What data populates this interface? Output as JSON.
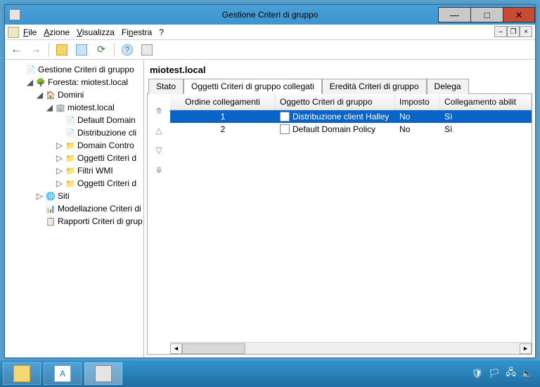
{
  "window": {
    "title": "Gestione Criteri di gruppo",
    "min": "—",
    "max": "□",
    "close": "✕"
  },
  "mdi": {
    "min": "–",
    "restore": "❐",
    "close": "×"
  },
  "menu": {
    "file": "File",
    "file_u": "F",
    "action": "Azione",
    "action_u": "A",
    "view": "Visualizza",
    "view_u": "V",
    "window": "Finestra",
    "window_u": "n",
    "help": "?"
  },
  "toolbar": {
    "back": "←",
    "forward": "→",
    "up": "up",
    "props": "props",
    "refresh": "⟳",
    "help": "?",
    "show": "show"
  },
  "tree": {
    "root": "Gestione Criteri di gruppo",
    "forest": "Foresta: miotest.local",
    "domains": "Domini",
    "domain": "miotest.local",
    "items": {
      "ddp": "Default Domain",
      "dist": "Distribuzione cli",
      "dc": "Domain Contro",
      "ogg": "Oggetti Criteri d",
      "wmi": "Filtri WMI",
      "ogg2": "Oggetti Criteri d"
    },
    "sites": "Siti",
    "modeling": "Modellazione Criteri di",
    "reports": "Rapporti Criteri di grup"
  },
  "content": {
    "title": "miotest.local",
    "tabs": {
      "stato": "Stato",
      "linked": "Oggetti Criteri di gruppo collegati",
      "inherit": "Eredità Criteri di gruppo",
      "delega": "Delega"
    },
    "columns": {
      "order": "Ordine collegamenti",
      "gpo": "Oggetto Criteri di gruppo",
      "enforced": "Imposto",
      "linkenabled": "Collegamento abilit"
    },
    "rows": [
      {
        "order": "1",
        "gpo": "Distribuzione client Halley",
        "enforced": "No",
        "linkenabled": "Sì",
        "selected": true
      },
      {
        "order": "2",
        "gpo": "Default Domain Policy",
        "enforced": "No",
        "linkenabled": "Sì",
        "selected": false
      }
    ],
    "arrows": {
      "top": "⤊",
      "up": "△",
      "down": "▽",
      "bottom": "⤋"
    },
    "hscroll": {
      "left": "◄",
      "right": "►"
    }
  },
  "tray": {
    "flag": "🏳",
    "speaker": "🔈",
    "net": "🖧",
    "security": "🛡"
  }
}
